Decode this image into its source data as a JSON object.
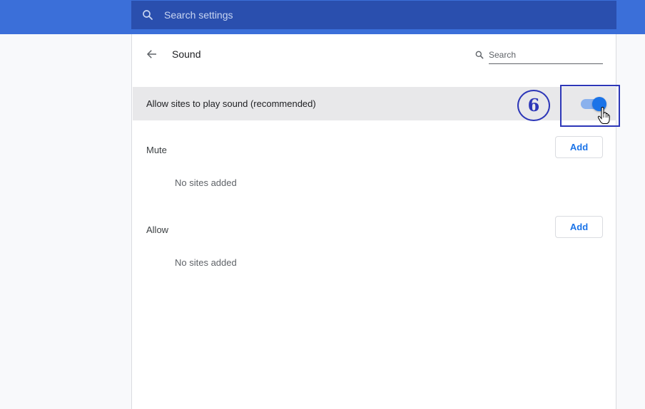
{
  "header": {
    "search_placeholder": "Search settings",
    "search_icon": "search-icon",
    "colors": {
      "header_bg": "#3b6fd9",
      "search_bg": "#2a4fae"
    }
  },
  "page": {
    "title": "Sound",
    "back_icon": "arrow-left-icon",
    "sub_search_placeholder": "Search"
  },
  "setting": {
    "label": "Allow sites to play sound (recommended)",
    "toggle_on": true,
    "annotation_number": "6",
    "accent_color": "#1a73e8",
    "annotation_color": "#2d37b8"
  },
  "sections": [
    {
      "title": "Mute",
      "add_label": "Add",
      "empty_text": "No sites added"
    },
    {
      "title": "Allow",
      "add_label": "Add",
      "empty_text": "No sites added"
    }
  ]
}
